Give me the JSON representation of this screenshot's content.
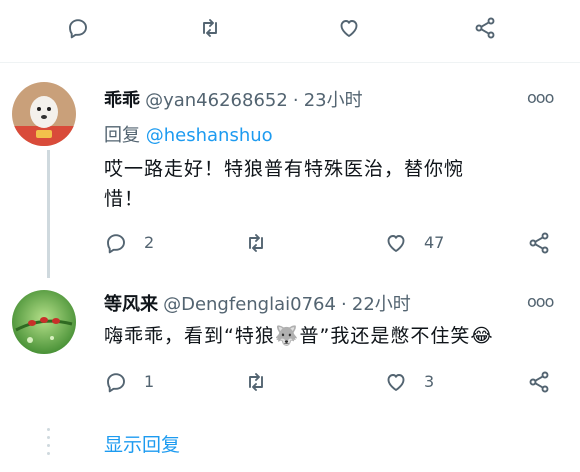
{
  "top_actions": {
    "reply_label": "",
    "retweet_label": "",
    "like_label": "",
    "share_label": ""
  },
  "tweets": [
    {
      "display_name": "乖乖",
      "handle": "@yan46268652",
      "separator": "·",
      "time": "23小时",
      "reply_prefix": "回复",
      "reply_mention": "@heshanshuo",
      "text_line1": "哎一路走好！特狼普有特殊医治，替你惋",
      "text_line2": "惜！",
      "replies": "2",
      "retweets": "",
      "likes": "47",
      "more": "ooo"
    },
    {
      "display_name": "等风来",
      "handle": "@Dengfenglai0764",
      "separator": "·",
      "time": "22小时",
      "text_part1": "嗨乖乖，看到“特狼",
      "emoji_wolf": "🐺",
      "text_part2": "普”我还是憋不住笑",
      "emoji_laugh": "😂",
      "replies": "1",
      "retweets": "",
      "likes": "3",
      "more": "ooo"
    }
  ],
  "show_replies_label": "显示回复",
  "colors": {
    "accent": "#1d9bf0",
    "muted": "#536471",
    "thread_line": "#cfd9de"
  }
}
